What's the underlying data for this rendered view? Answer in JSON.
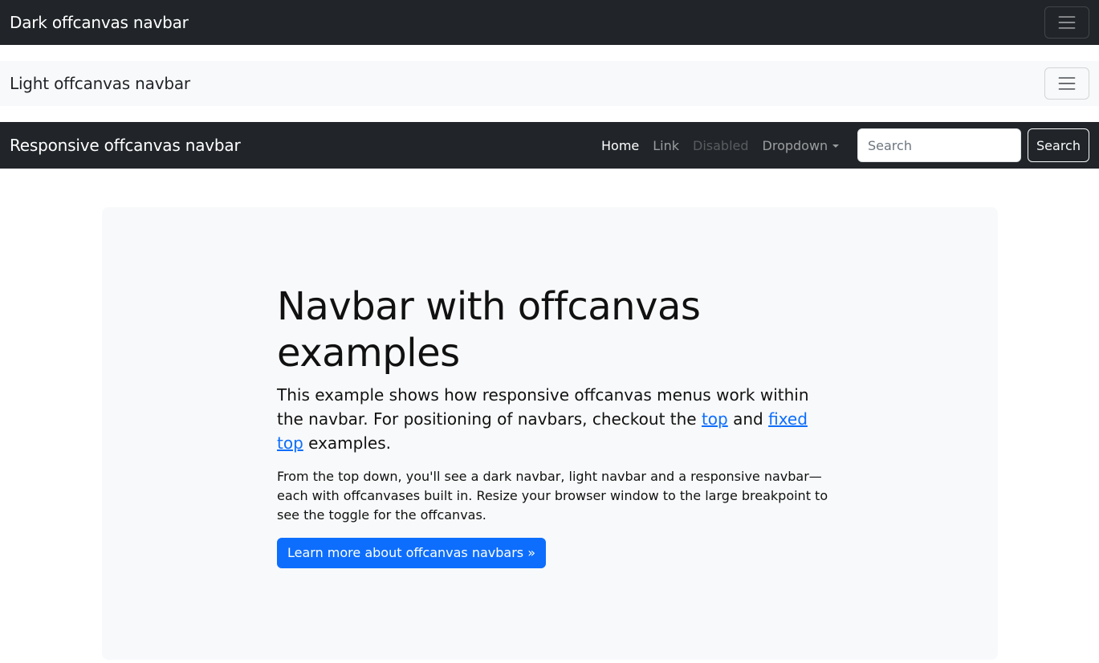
{
  "navbars": {
    "dark": {
      "brand": "Dark offcanvas navbar",
      "toggler_icon": "hamburger-icon"
    },
    "light": {
      "brand": "Light offcanvas navbar",
      "toggler_icon": "hamburger-icon"
    },
    "responsive": {
      "brand": "Responsive offcanvas navbar",
      "links": {
        "home": "Home",
        "link": "Link",
        "disabled": "Disabled",
        "dropdown": "Dropdown"
      },
      "search": {
        "placeholder": "Search",
        "value": "",
        "button_label": "Search"
      }
    }
  },
  "hero": {
    "title": "Navbar with offcanvas examples",
    "lead_part1": "This example shows how responsive offcanvas menus work within the navbar. For positioning of navbars, checkout the ",
    "lead_link_top": "top",
    "lead_and": " and ",
    "lead_link_fixed_top": "fixed top",
    "lead_part2": " examples.",
    "body": "From the top down, you'll see a dark navbar, light navbar and a responsive navbar—each with offcanvases built in. Resize your browser window to the large breakpoint to see the toggle for the offcanvas.",
    "button_label": "Learn more about offcanvas navbars »"
  },
  "colors": {
    "dark_bg": "#212529",
    "light_bg": "#f8f9fa",
    "primary": "#0d6efd"
  }
}
